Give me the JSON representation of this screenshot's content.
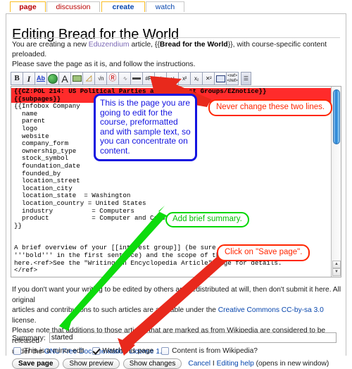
{
  "tabs": [
    {
      "label": "page",
      "state": "selected",
      "color": "red"
    },
    {
      "label": "discussion",
      "state": "normal",
      "color": "red"
    },
    {
      "label": "create",
      "state": "selected",
      "color": "blue"
    },
    {
      "label": "watch",
      "state": "normal",
      "color": "blue"
    }
  ],
  "page": {
    "title": "Editing Bread for the World",
    "intro_pre": "You are creating a new ",
    "intro_link": "Eduzendium",
    "intro_mid": " article, {{",
    "intro_bold": "Bread for the World",
    "intro_post": "}}, with course-specific content preloaded.",
    "intro_line2": "Please save the page as it is, and follow the instructions."
  },
  "toolbar": {
    "buttons": [
      {
        "name": "bold-button",
        "glyph": "B"
      },
      {
        "name": "italic-button",
        "glyph": "I"
      },
      {
        "name": "internal-link-button",
        "glyph": "Ab"
      },
      {
        "name": "external-link-button",
        "glyph": "globe"
      },
      {
        "name": "headline-button",
        "glyph": "A"
      },
      {
        "name": "embedded-image-button",
        "glyph": "image"
      },
      {
        "name": "media-file-button",
        "glyph": "horn"
      },
      {
        "name": "math-formula-button",
        "glyph": "√n"
      },
      {
        "name": "nowiki-button",
        "glyph": "no-wiki"
      },
      {
        "name": "signature-button",
        "glyph": "signature"
      },
      {
        "name": "horizontal-line-button",
        "glyph": "dash"
      },
      {
        "name": "redirect-button",
        "glyph": "#R"
      },
      {
        "name": "strikethrough-button",
        "glyph": "strk"
      },
      {
        "name": "line-break-button",
        "glyph": "↵"
      },
      {
        "name": "superscript-button",
        "glyph": "x2sup"
      },
      {
        "name": "subscript-button",
        "glyph": "x2sub"
      },
      {
        "name": "multiply-button",
        "glyph": "x2mul"
      },
      {
        "name": "table-button",
        "glyph": "table"
      },
      {
        "name": "reference-button",
        "glyph": "ref"
      }
    ],
    "last_button_name": "special-characters-button"
  },
  "editor": {
    "highlighted_lines": [
      "{{CZ:POL 214: US Political Parties and Interest Groups/EZnotice}}",
      "{{subpages}}"
    ],
    "infobox_open": "{{Infobox Company",
    "infobox_fields": [
      {
        "key": "name",
        "value": ""
      },
      {
        "key": "parent",
        "value": ""
      },
      {
        "key": "logo",
        "value": ""
      },
      {
        "key": "website",
        "value": ""
      },
      {
        "key": "company_form",
        "value": ""
      },
      {
        "key": "ownership_type",
        "value": ""
      },
      {
        "key": "stock_symbol",
        "value": ""
      },
      {
        "key": "foundation_date",
        "value": ""
      },
      {
        "key": "founded_by",
        "value": ""
      },
      {
        "key": "location_street",
        "value": ""
      },
      {
        "key": "location_city",
        "value": ""
      },
      {
        "key": "location_state",
        "value": "= Washington"
      },
      {
        "key": "location_country",
        "value": "= United States"
      },
      {
        "key": "industry",
        "value": "= Computers"
      },
      {
        "key": "product",
        "value": "= Computer and Consumer Products"
      }
    ],
    "infobox_close": "}}",
    "body_text": "A brief overview of your [[interest group]] (be sure to put its name in\n'''bold''' in the first sentence) and the scope of the article goes\nhere.<ref>See the \"Writing an Encyclopedia Article\" page for details.\n</ref>"
  },
  "license": {
    "line1_a": "If you don't want your writing to be edited by others and redistributed at will, then don't submit it here. All original",
    "line2_a": "articles and contributions to such articles are available under the ",
    "line2_link": "Creative Commons CC-by-sa 3.0",
    "line2_b": " license.",
    "line3_a": "Please note that additions to those articles that are marked as from Wikipedia are considered to be released",
    "line4_a": "under the ",
    "line4_link": "GNU Free Documentation License 1.2",
    "line4_b": "."
  },
  "summary": {
    "label": "Summary:",
    "value": "started",
    "placeholder": ""
  },
  "checkboxes": [
    {
      "label": "This is a minor edit",
      "checked": false,
      "name": "minor-edit-checkbox"
    },
    {
      "label": "Watch this page",
      "checked": true,
      "name": "watch-page-checkbox"
    },
    {
      "label": "Content is from Wikipedia?",
      "checked": false,
      "name": "from-wikipedia-checkbox"
    }
  ],
  "buttons": {
    "save": "Save page",
    "preview": "Show preview",
    "changes": "Show changes",
    "cancel": "Cancel",
    "separator": " I ",
    "editing_help": "Editing help",
    "help_note": " (opens in new window)"
  },
  "annotations": {
    "blue_note": "This is the page you are going to edit for the course, preformatted and with sample text, so you can concentrate on content.",
    "red_note_1": "Never change these two lines.",
    "red_note_2": "Click on \"Save page\".",
    "green_note": "Add brief summary."
  },
  "colors": {
    "annotation_blue": "#1414e0",
    "annotation_red": "#ff2600",
    "annotation_green": "#00d700",
    "highlight_red": "#ff2b2b",
    "link_blue": "#0645ad",
    "tab_red": "#ba0000",
    "tab_orange": "#fabd23"
  }
}
